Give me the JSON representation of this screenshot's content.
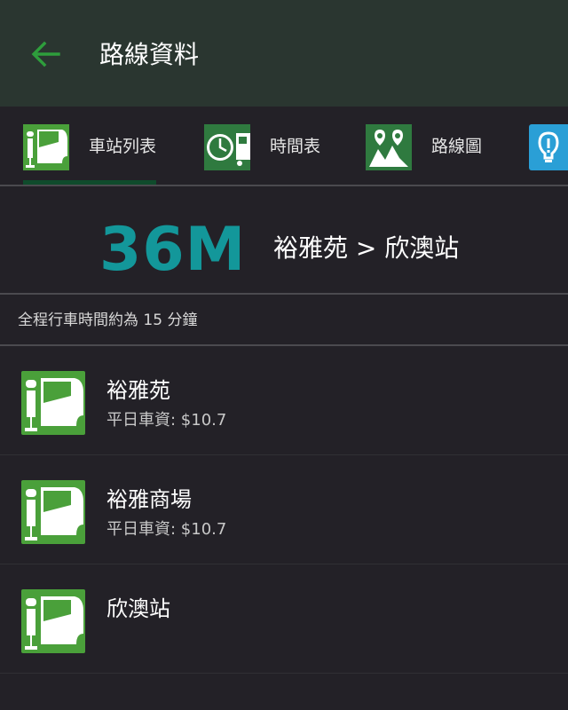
{
  "appbar": {
    "title": "路線資料",
    "back_icon": "arrow-left-icon",
    "accent": "#2e9e3c"
  },
  "tabs": [
    {
      "label": "車站列表",
      "icon": "bus-stop-icon",
      "selected": true
    },
    {
      "label": "時間表",
      "icon": "timetable-icon",
      "selected": false
    },
    {
      "label": "路線圖",
      "icon": "route-map-icon",
      "selected": false
    },
    {
      "label": "",
      "icon": "info-icon",
      "selected": false
    }
  ],
  "route": {
    "number": "36M",
    "direction": "裕雅苑 > 欣澳站",
    "number_color": "#13979a"
  },
  "journey_time": "全程行車時間約為 15 分鐘",
  "stops": [
    {
      "name": "裕雅苑",
      "fare": "平日車資: $10.7"
    },
    {
      "name": "裕雅商場",
      "fare": "平日車資: $10.7"
    },
    {
      "name": "欣澳站",
      "fare": ""
    }
  ]
}
